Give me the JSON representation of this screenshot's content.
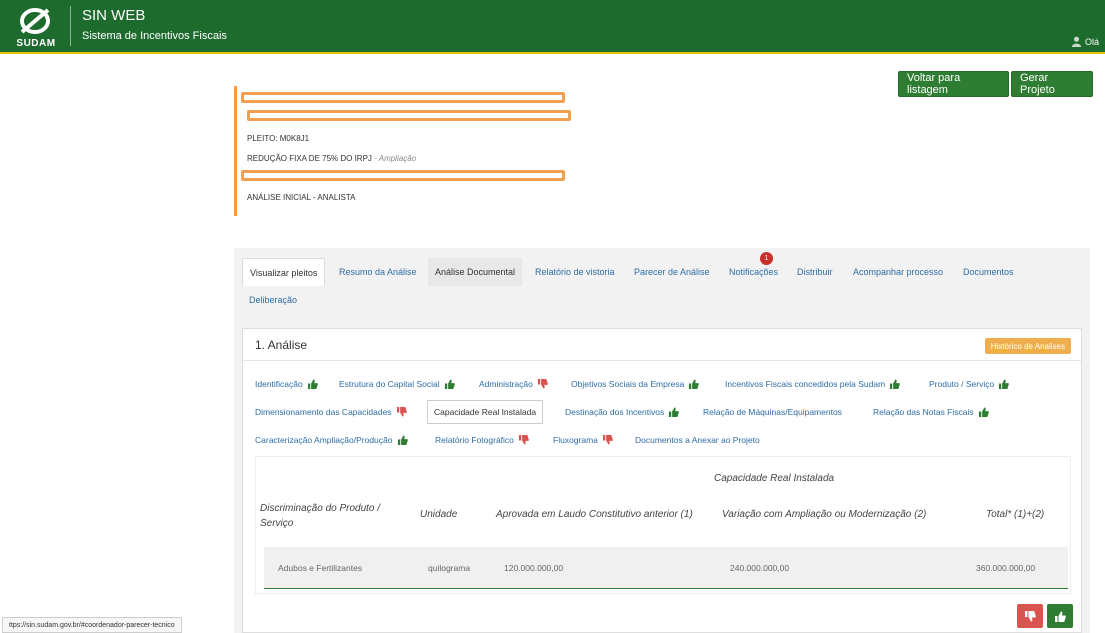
{
  "header": {
    "logo_text": "SUDAM",
    "app_title": "SIN WEB",
    "app_subtitle": "Sistema de Incentivos Fiscais",
    "user_greeting": "Olá",
    "colors": {
      "bar": "#1e6b2e",
      "accent_line": "#e0c400"
    }
  },
  "actions": {
    "back_label": "Voltar para listagem",
    "generate_label": "Gerar Projeto"
  },
  "info": {
    "pleito": "PLEITO: M0K8J1",
    "reducao": "REDUÇÃO FIXA DE 75% DO IRPJ",
    "reducao_suffix": " - Ampliação",
    "etapa": "ANÁLISE INICIAL - ANALISTA"
  },
  "tabs": [
    {
      "label": "Visualizar pleitos"
    },
    {
      "label": "Resumo da Análise"
    },
    {
      "label": "Análise Documental"
    },
    {
      "label": "Relatório de vistoria"
    },
    {
      "label": "Parecer de Análise"
    },
    {
      "label": "Notificações"
    },
    {
      "label": "Distribuir"
    },
    {
      "label": "Acompanhar processo"
    },
    {
      "label": "Documentos"
    },
    {
      "label": "Deliberação"
    }
  ],
  "notifications_badge": "1",
  "card": {
    "title": "1. Análise",
    "history_button": "Histórico de Analises"
  },
  "subtabs": [
    {
      "label": "Identificação",
      "status": "up"
    },
    {
      "label": "Estrutura do Capital Social",
      "status": "up"
    },
    {
      "label": "Administração",
      "status": "down"
    },
    {
      "label": "Objetivos Sociais da Empresa",
      "status": "up"
    },
    {
      "label": "Incentivos Fiscais concedidos pela Sudam",
      "status": "up"
    },
    {
      "label": "Produto / Serviço",
      "status": "up"
    },
    {
      "label": "Dimensionamento das Capacidades",
      "status": "down"
    },
    {
      "label": "Capacidade Real Instalada",
      "status": "active"
    },
    {
      "label": "Destinação dos Incentivos",
      "status": "up"
    },
    {
      "label": "Relação de Máquinas/Equipamentos",
      "status": "none"
    },
    {
      "label": "Relação das Notas Fiscais",
      "status": "up"
    },
    {
      "label": "Caracterização Ampliação/Produção",
      "status": "up"
    },
    {
      "label": "Relatório Fotográfico",
      "status": "down"
    },
    {
      "label": "Fluxograma",
      "status": "down"
    },
    {
      "label": "Documentos a Anexar ao Projeto",
      "status": "none"
    }
  ],
  "table": {
    "group_header": "Capacidade Real Instalada",
    "columns": [
      "Discriminação do Produto / Serviço",
      "Unidade",
      "Aprovada em Laudo Constitutivo anterior (1)",
      "Variação com Ampliação ou Modernização (2)",
      "Total* (1)+(2)"
    ],
    "rows": [
      [
        "Adubos e Fertilizantes",
        "quilograma",
        "120.000.000,00",
        "240.000.000,00",
        "360.000.000,00"
      ]
    ]
  },
  "status_url": "ttps://sin.sudam.gov.br/#coordenador-parecer-tecnico"
}
